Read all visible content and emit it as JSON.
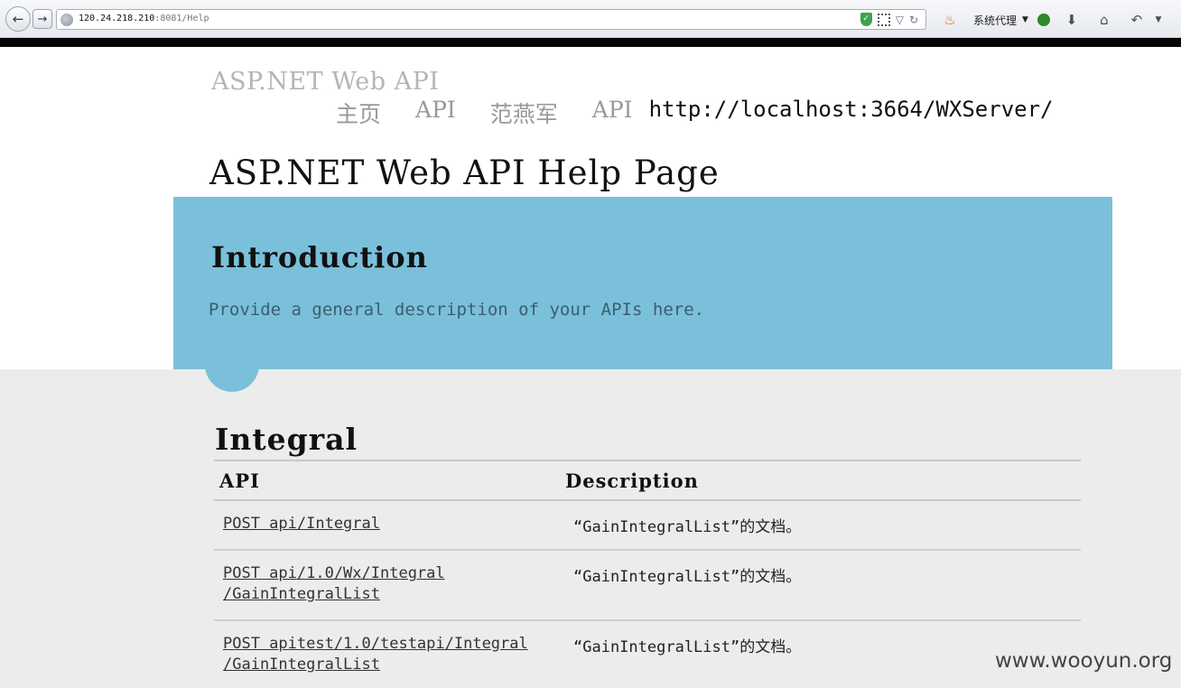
{
  "browser": {
    "url_host": "120.24.218.210",
    "url_rest": ":8081/Help",
    "proxy_label": "系统代理"
  },
  "site": {
    "title": "ASP.NET Web API",
    "nav": [
      {
        "label": "主页"
      },
      {
        "label": "API"
      },
      {
        "label": "范燕军"
      },
      {
        "label": "API"
      }
    ],
    "nav_url": "http://localhost:3664/WXServer/"
  },
  "page": {
    "heading": "ASP.NET Web API Help Page"
  },
  "intro": {
    "title": "Introduction",
    "text": "Provide a general description of your APIs here."
  },
  "section": {
    "title": "Integral",
    "columns": [
      "API",
      "Description"
    ],
    "rows": [
      {
        "api": [
          "POST api/Integral"
        ],
        "description": "“GainIntegralList”的文档。"
      },
      {
        "api": [
          "POST api/1.0/Wx/Integral",
          "/GainIntegralList"
        ],
        "description": "“GainIntegralList”的文档。"
      },
      {
        "api": [
          "POST apitest/1.0/testapi/Integral",
          "/GainIntegralList"
        ],
        "description": "“GainIntegralList”的文档。"
      }
    ]
  },
  "watermark": "www.wooyun.org",
  "colors": {
    "intro_bg": "#7ac0da",
    "gray_bg": "#ececec"
  }
}
